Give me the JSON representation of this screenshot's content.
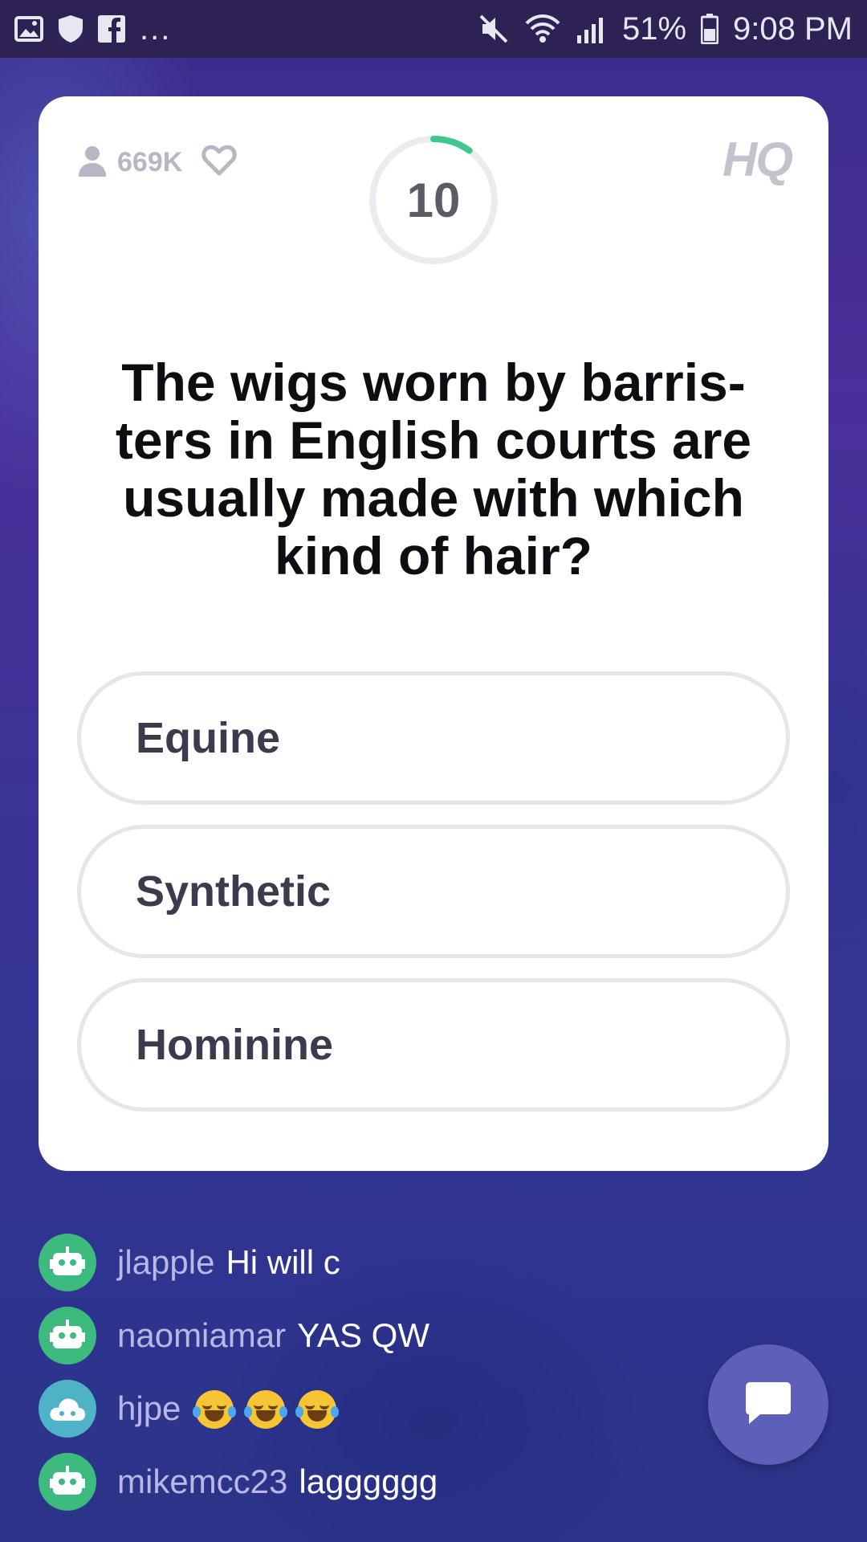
{
  "status_bar": {
    "notif_icons": [
      "image-icon",
      "shield-icon",
      "facebook-icon"
    ],
    "more": "...",
    "battery": "51%",
    "time": "9:08 PM"
  },
  "game": {
    "viewers": "669K",
    "timer": "10",
    "timer_progress": 0.1,
    "logo": "HQ",
    "question": "The wigs worn by barris-ters in English courts are usually made with which kind of hair?",
    "answers": [
      {
        "label": "Equine"
      },
      {
        "label": "Synthetic"
      },
      {
        "label": "Hominine"
      }
    ]
  },
  "colors": {
    "timer_accent": "#3ec78e",
    "avatar_green": "#3dbb7e",
    "avatar_teal": "#4fb3c8",
    "chat_button": "#5d5fb8"
  },
  "chat": [
    {
      "user": "jlapple",
      "message": "Hi will c",
      "avatar": "robot-icon"
    },
    {
      "user": "naomiamar",
      "message": "YAS QW",
      "avatar": "robot-icon"
    },
    {
      "user": "hjpe",
      "message": "",
      "avatar": "cloud-icon",
      "emojis": [
        "crying-laughing-emoji",
        "crying-laughing-emoji",
        "crying-laughing-emoji"
      ]
    },
    {
      "user": "mikemcc23",
      "message": "lagggggg",
      "avatar": "robot-icon"
    }
  ]
}
